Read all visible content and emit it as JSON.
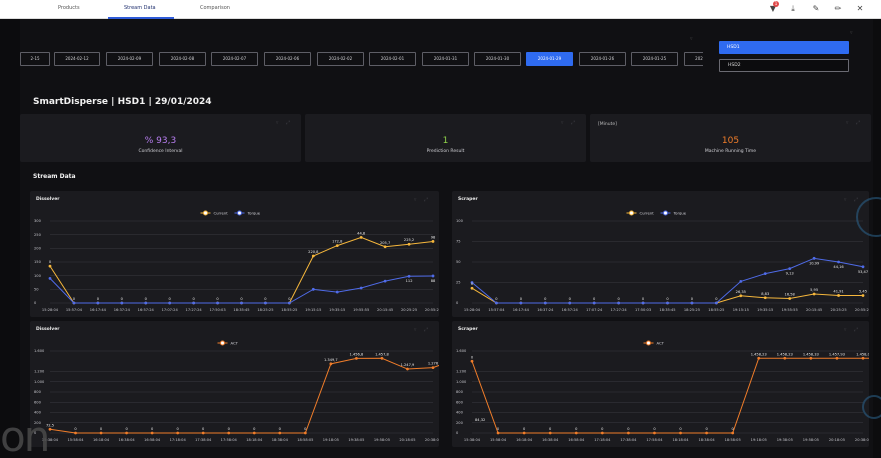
{
  "topbar": {
    "tabs": [
      "Products",
      "Stream Data",
      "Comparison"
    ],
    "active_tab": "Stream Data",
    "notification_count": "1"
  },
  "date_strip": {
    "dates": [
      "2024-02-15",
      "2024-02-12",
      "2024-02-09",
      "2024-02-08",
      "2024-02-07",
      "2024-02-06",
      "2024-02-02",
      "2024-02-01",
      "2024-01-31",
      "2024-01-30",
      "2024-01-29",
      "2024-01-26",
      "2024-01-25",
      "2024-01-24"
    ],
    "labels": [
      "2-15",
      "2024-02-12",
      "2024-02-09",
      "2024-02-08",
      "2024-02-07",
      "2024-02-06",
      "2024-02-02",
      "2024-02-01",
      "2024-01-31",
      "2024-01-30",
      "2024-01-29",
      "2024-01-26",
      "2024-01-25",
      "202"
    ],
    "active": "2024-01-29"
  },
  "hsd_options": [
    "HSD1",
    "HSD2"
  ],
  "hsd_selected": "HSD1",
  "page_title": "SmartDisperse | HSD1 | 29/01/2024",
  "kpis": [
    {
      "value": "% 93,3",
      "label": "Confidence Interval",
      "unit": "",
      "color": "#b77ef0"
    },
    {
      "value": "1",
      "label": "Prediction Result",
      "unit": "",
      "color": "#8fd34a"
    },
    {
      "value": "105",
      "label": "Machine Running Time",
      "unit": "[Minute]",
      "color": "#f07d2a"
    }
  ],
  "section_title": "Stream Data",
  "chart_data": [
    {
      "type": "line",
      "title": "Dissolver",
      "x": [
        "15:28:04",
        "15:57:04",
        "16:17:44",
        "16:37:24",
        "16:57:24",
        "17:07:24",
        "17:27:24",
        "17:50:03",
        "18:35:45",
        "18:25:25",
        "18:55:25",
        "19:15:15",
        "19:35:15",
        "19:55:55",
        "20:15:45",
        "20:25:25",
        "20:55:25"
      ],
      "series": [
        {
          "name": "Current",
          "color": "#f6b73c",
          "values": [
            135,
            0,
            0,
            0,
            0,
            0,
            0,
            0,
            0,
            0,
            0,
            172,
            210,
            240,
            205.7,
            215,
            225.2
          ]
        },
        {
          "name": "Torque",
          "color": "#4f6be8",
          "values": [
            90,
            0,
            0,
            0,
            0,
            0,
            0,
            0,
            0,
            0,
            0,
            50,
            40,
            55,
            80,
            98,
            99
          ]
        }
      ],
      "labels": [
        "0",
        "0",
        "0",
        "0",
        "0",
        "0",
        "0",
        "0",
        "0",
        "0",
        "0",
        "220,8",
        "172,8",
        "44,8",
        "205,7",
        "225,2",
        "98",
        "88",
        "112"
      ],
      "ylim": [
        0,
        300
      ],
      "yticks": [
        "0",
        "50",
        "100",
        "150",
        "200",
        "250",
        "300"
      ],
      "legend": "top-center"
    },
    {
      "type": "line",
      "title": "Scraper",
      "x": [
        "15:28:04",
        "15:57:04",
        "16:17:44",
        "16:37:24",
        "16:57:24",
        "17:07:24",
        "17:27:24",
        "17:50:03",
        "18:35:45",
        "18:25:25",
        "18:55:25",
        "19:15:15",
        "19:35:15",
        "19:55:55",
        "20:15:45",
        "20:25:25",
        "20:55:25"
      ],
      "series": [
        {
          "name": "Current",
          "color": "#f6b73c",
          "values": [
            18,
            0,
            0,
            0,
            0,
            0,
            0,
            0,
            0,
            0,
            0,
            8.83,
            6.4,
            5.45,
            10.99,
            9.2,
            9.13
          ]
        },
        {
          "name": "Torque",
          "color": "#4f6be8",
          "values": [
            25,
            0,
            0,
            0,
            0,
            0,
            0,
            0,
            0,
            0,
            0,
            26.35,
            35.8,
            41.91,
            54.47,
            50,
            44.16
          ]
        }
      ],
      "labels": [
        "0",
        "0",
        "0",
        "0",
        "0",
        "0",
        "0",
        "0",
        "0",
        "0",
        "0",
        "26,35",
        "8,83",
        "16,58",
        "5,95",
        "41,91",
        "5,45",
        "53,47",
        "44,16",
        "10,99",
        "9,13"
      ],
      "ylim": [
        0,
        100
      ],
      "yticks": [
        "0",
        "25",
        "50",
        "75",
        "100"
      ],
      "legend": "top-center"
    },
    {
      "type": "line",
      "title": "Dissolver",
      "x": [
        "15:38:04",
        "15:58:04",
        "16:18:04",
        "16:38:04",
        "16:58:04",
        "17:18:04",
        "17:38:04",
        "17:58:04",
        "18:18:04",
        "18:38:04",
        "18:58:05",
        "19:18:05",
        "19:38:05",
        "19:58:05",
        "20:18:05",
        "20:38:05"
      ],
      "series": [
        {
          "name": "ACT",
          "color": "#f07d2a",
          "values": [
            72.5,
            0,
            0,
            0,
            0,
            0,
            0,
            0,
            0,
            0,
            0,
            1349.7,
            1456.8,
            1457.8,
            1247.9,
            1276,
            1456.7
          ]
        }
      ],
      "labels": [
        "72,5",
        "0",
        "0",
        "0",
        "0",
        "0",
        "0",
        "0",
        "0",
        "0",
        "0",
        "1.349,7",
        "1.456,8",
        "1.457,8",
        "1.247,9",
        "1.276",
        "1.456,7"
      ],
      "ylim": [
        0,
        1600
      ],
      "yticks": [
        "0",
        "200",
        "400",
        "600",
        "800",
        "1.000",
        "1.200",
        "1.600"
      ],
      "legend": "top-center"
    },
    {
      "type": "line",
      "title": "Scraper",
      "x": [
        "15:38:04",
        "15:58:04",
        "16:18:04",
        "16:38:04",
        "16:58:04",
        "17:18:04",
        "17:38:04",
        "17:58:04",
        "18:18:04",
        "18:38:04",
        "18:58:05",
        "19:18:05",
        "19:38:05",
        "19:58:05",
        "20:18:05",
        "20:38:05"
      ],
      "series": [
        {
          "name": "ACT",
          "color": "#f07d2a",
          "values": [
            1400,
            0,
            0,
            0,
            0,
            0,
            0,
            0,
            0,
            0,
            0,
            1458.23,
            1458.23,
            1458.33,
            1457.93,
            1458.0,
            1458.05
          ]
        }
      ],
      "labels": [
        "0",
        "0",
        "0",
        "0",
        "0",
        "0",
        "0",
        "0",
        "0",
        "0",
        "0",
        "1.458,23",
        "1.458,23",
        "1.458,33",
        "1.457,93",
        "1.458,0",
        "1.458,05",
        "84,32"
      ],
      "ylim": [
        0,
        1600
      ],
      "yticks": [
        "0",
        "200",
        "400",
        "600",
        "800",
        "1.000",
        "1.200",
        "1.600"
      ],
      "legend": "top-center"
    }
  ],
  "bottom_fragment": "on"
}
